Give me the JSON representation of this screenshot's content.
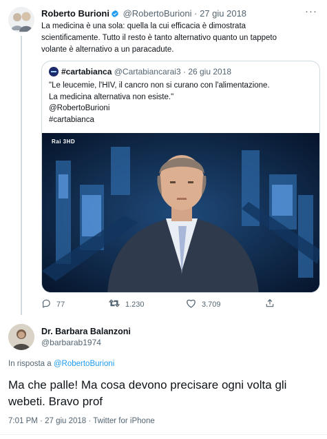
{
  "original_tweet": {
    "author_name": "Roberto Burioni",
    "handle": "@RobertoBurioni",
    "separator": "·",
    "date": "27 giu 2018",
    "more_menu": "···",
    "text_lines": [
      "La medicina è una sola: quella la cui efficacia è dimostrata",
      "scientificamente.  Tutto il resto è tanto alternativo quanto un tappeto",
      "volante è alternativo a un paracadute."
    ],
    "verified_color": "#1d9bf0",
    "icons": {
      "verified": "verified-badge-icon",
      "more": "more-icon"
    }
  },
  "quoted_tweet": {
    "name": "#cartabianca",
    "handle": "@Cartabiancarai3",
    "separator": "·",
    "date": "26 giu 2018",
    "text_lines": [
      "\"Le leucemie, l'HIV, il cancro non si curano con l'alimentazione.",
      "La medicina alternativa non esiste.\"",
      "@RobertoBurioni",
      "#cartabianca"
    ],
    "media_logo": "Rai 3HD"
  },
  "actions": {
    "replies": "77",
    "retweets": "1.230",
    "likes": "3.709",
    "icons": [
      "reply-icon",
      "retweet-icon",
      "like-icon",
      "share-icon"
    ]
  },
  "reply_tweet": {
    "author_name": "Dr. Barbara Balanzoni",
    "handle": "@barbarab1974",
    "in_reply_prefix": "In risposta a",
    "in_reply_handle": "@RobertoBurioni",
    "text_lines": [
      "Ma che palle! Ma cosa devono precisare ogni volta gli",
      "webeti. Bravo prof"
    ],
    "time": "7:01 PM",
    "date": "27 giu 2018",
    "client": "Twitter for iPhone",
    "separator": "·"
  },
  "colors": {
    "link": "#1d9bf0",
    "muted": "#536471",
    "text": "#0f1419",
    "border": "#cfd9de"
  }
}
